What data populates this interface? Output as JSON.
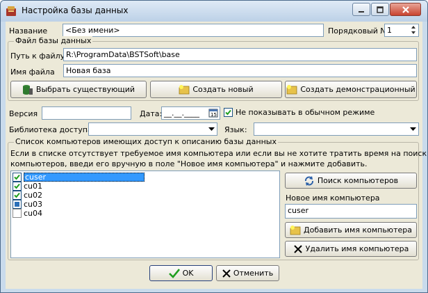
{
  "window": {
    "title": "Настройка базы данных"
  },
  "form": {
    "name_label": "Название",
    "name_value": "<Без имени>",
    "order_label": "Порядковый №",
    "order_value": "1",
    "file_group_title": "Файл базы данных",
    "path_label": "Путь к файлу",
    "path_value": "R:\\ProgramData\\BSTSoft\\base",
    "filename_label": "Имя файла",
    "filename_value": "Новая база",
    "btn_choose_existing": "Выбрать существующий",
    "btn_create_new": "Создать новый",
    "btn_create_demo": "Создать демонстрационный",
    "version_label": "Версия",
    "version_value": "",
    "date_label": "Дата:",
    "date_value": "__.__.____",
    "hide_checkbox_label": "Не показывать в обычном режиме",
    "hide_checkbox_checked": true,
    "library_label": "Библиотека доступа",
    "library_value": "",
    "language_label": "Язык:",
    "language_value": ""
  },
  "computers": {
    "group_title": "Список компьютеров имеющих доступ к описанию базы данных",
    "hint_line1": "Если в списке отсутствует требуемое имя компьютера или если вы не хотите тратить время на поиск",
    "hint_line2": "компьютеров, введи его вручную в поле \"Новое имя компьютера\" и нажмите добавить.",
    "items": [
      {
        "name": "cuser",
        "state": "checked",
        "selected": true
      },
      {
        "name": "cu01",
        "state": "checked",
        "selected": false
      },
      {
        "name": "cu02",
        "state": "checked",
        "selected": false
      },
      {
        "name": "cu03",
        "state": "indeterminate",
        "selected": false
      },
      {
        "name": "cu04",
        "state": "unchecked",
        "selected": false
      }
    ],
    "btn_search": "Поиск компьютеров",
    "new_name_label": "Новое имя компьютера",
    "new_name_value": "cuser",
    "btn_add": "Добавить имя компьютера",
    "btn_delete": "Удалить имя компьютера"
  },
  "footer": {
    "ok_label": "OK",
    "cancel_label": "Отменить"
  },
  "colors": {
    "selection": "#3399ff",
    "window_bg": "#ece9d8",
    "frame": "#c9dbec"
  }
}
